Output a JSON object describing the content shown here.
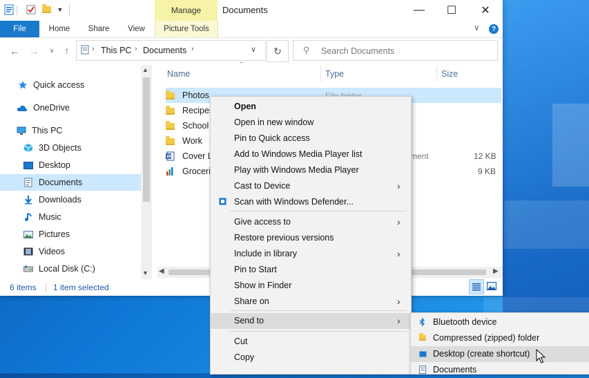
{
  "window": {
    "title": "Documents",
    "context_tab": "Manage",
    "controls": {
      "minimize": "—",
      "maximize": "☐",
      "close": "✕"
    }
  },
  "ribbon": {
    "tabs": [
      "File",
      "Home",
      "Share",
      "View",
      "Picture Tools"
    ],
    "collapse": "∨",
    "help": "?"
  },
  "address": {
    "crumbs": [
      "This PC",
      "Documents"
    ],
    "search_placeholder": "Search Documents"
  },
  "nav_pane": [
    {
      "label": "Quick access",
      "icon": "star-icon"
    },
    {
      "label": "OneDrive",
      "icon": "cloud-icon"
    },
    {
      "label": "This PC",
      "icon": "computer-icon"
    },
    {
      "label": "3D Objects",
      "icon": "cube-icon"
    },
    {
      "label": "Desktop",
      "icon": "desktop-icon"
    },
    {
      "label": "Documents",
      "icon": "document-icon"
    },
    {
      "label": "Downloads",
      "icon": "download-icon"
    },
    {
      "label": "Music",
      "icon": "music-icon"
    },
    {
      "label": "Pictures",
      "icon": "picture-icon"
    },
    {
      "label": "Videos",
      "icon": "video-icon"
    },
    {
      "label": "Local Disk (C:)",
      "icon": "disk-icon"
    }
  ],
  "columns": {
    "name": "Name",
    "type": "Type",
    "size": "Size"
  },
  "files": [
    {
      "name": "Photos",
      "type": "File folder",
      "size": "",
      "icon": "folder-icon"
    },
    {
      "name": "Recipes",
      "type": "",
      "size": "",
      "icon": "folder-icon"
    },
    {
      "name": "School",
      "type": "",
      "size": "",
      "icon": "folder-icon"
    },
    {
      "name": "Work",
      "type": "",
      "size": "",
      "icon": "folder-icon"
    },
    {
      "name": "Cover L",
      "type": "ment",
      "size": "12 KB",
      "icon": "word-doc-icon"
    },
    {
      "name": "Groceri",
      "type": "",
      "size": "9 KB",
      "icon": "chart-file-icon"
    }
  ],
  "status": {
    "items": "6 items",
    "selected": "1 item selected"
  },
  "context_menu": [
    {
      "label": "Open",
      "bold": true
    },
    {
      "label": "Open in new window"
    },
    {
      "label": "Pin to Quick access"
    },
    {
      "label": "Add to Windows Media Player list"
    },
    {
      "label": "Play with Windows Media Player"
    },
    {
      "label": "Cast to Device",
      "submenu": true
    },
    {
      "label": "Scan with Windows Defender...",
      "icon": "defender-icon"
    },
    {
      "label": "Give access to",
      "submenu": true
    },
    {
      "label": "Restore previous versions"
    },
    {
      "label": "Include in library",
      "submenu": true
    },
    {
      "label": "Pin to Start"
    },
    {
      "label": "Show in Finder"
    },
    {
      "label": "Share on",
      "submenu": true
    },
    {
      "label": "Send to",
      "submenu": true,
      "highlighted": true
    },
    {
      "label": "Cut"
    },
    {
      "label": "Copy"
    }
  ],
  "send_to_menu": [
    {
      "label": "Bluetooth device",
      "icon": "bluetooth-icon"
    },
    {
      "label": "Compressed (zipped) folder",
      "icon": "zip-folder-icon"
    },
    {
      "label": "Desktop (create shortcut)",
      "icon": "desktop-icon",
      "highlighted": true
    },
    {
      "label": "Documents",
      "icon": "document-icon"
    }
  ],
  "colors": {
    "accent": "#1979ca",
    "selection": "#cce8ff",
    "manage": "#f7f3a6"
  }
}
